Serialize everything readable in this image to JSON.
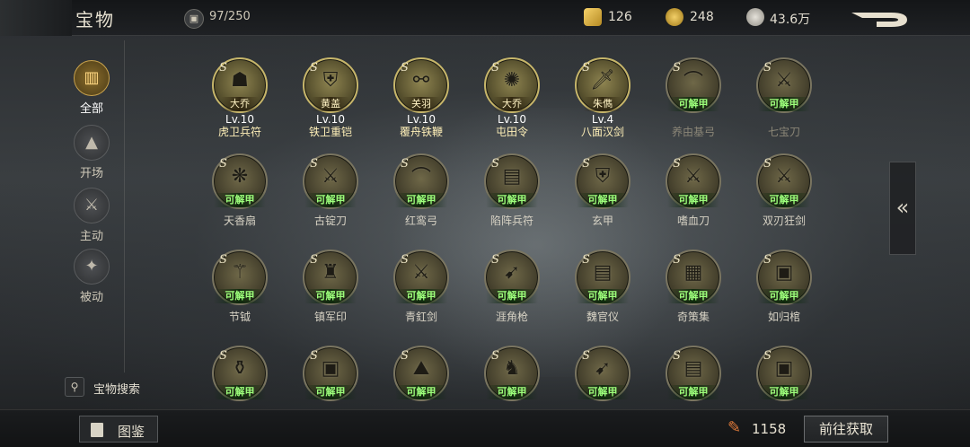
{
  "header": {
    "title": "宝物",
    "capacity": "97/250",
    "currency": [
      {
        "icon": "gold-ingot-icon",
        "value": "126"
      },
      {
        "icon": "gold-coin-icon",
        "value": "248"
      },
      {
        "icon": "silver-coin-icon",
        "value": "43.6万"
      }
    ]
  },
  "sidebar": {
    "items": [
      {
        "label": "全部",
        "icon": "all-icon"
      },
      {
        "label": "开场",
        "icon": "opening-icon"
      },
      {
        "label": "主动",
        "icon": "active-icon"
      },
      {
        "label": "被动",
        "icon": "passive-icon"
      }
    ],
    "search_label": "宝物搜索"
  },
  "tags": {
    "unlock": "可解甲"
  },
  "grid": [
    {
      "name": "虎卫兵符",
      "owner": "大乔",
      "level": "Lv.10",
      "state": "own"
    },
    {
      "name": "铁卫重铠",
      "owner": "黄盖",
      "level": "Lv.10",
      "state": "own"
    },
    {
      "name": "覆舟铁鞭",
      "owner": "关羽",
      "level": "Lv.10",
      "state": "own"
    },
    {
      "name": "屯田令",
      "owner": "大乔",
      "level": "Lv.10",
      "state": "own"
    },
    {
      "name": "八面汉剑",
      "owner": "朱儁",
      "level": "Lv.4",
      "state": "own"
    },
    {
      "name": "养由基弓",
      "state": "dim"
    },
    {
      "name": "七宝刀",
      "state": "dim"
    },
    {
      "name": "天香扇",
      "state": "plain"
    },
    {
      "name": "古锭刀",
      "state": "plain"
    },
    {
      "name": "红鸾弓",
      "state": "plain"
    },
    {
      "name": "陷阵兵符",
      "state": "plain"
    },
    {
      "name": "玄甲",
      "state": "plain"
    },
    {
      "name": "嗜血刀",
      "state": "plain"
    },
    {
      "name": "双刃狂剑",
      "state": "plain"
    },
    {
      "name": "节钺",
      "state": "plain"
    },
    {
      "name": "镇军印",
      "state": "plain"
    },
    {
      "name": "青釭剑",
      "state": "plain"
    },
    {
      "name": "涯角枪",
      "state": "plain"
    },
    {
      "name": "魏官仪",
      "state": "plain"
    },
    {
      "name": "奇策集",
      "state": "plain"
    },
    {
      "name": "如归棺",
      "state": "plain"
    },
    {
      "name": "",
      "state": "plain"
    },
    {
      "name": "",
      "state": "plain"
    },
    {
      "name": "",
      "state": "plain"
    },
    {
      "name": "",
      "state": "plain"
    },
    {
      "name": "",
      "state": "plain"
    },
    {
      "name": "",
      "state": "plain"
    },
    {
      "name": "",
      "state": "plain"
    }
  ],
  "collapse_glyph": "«",
  "bottom": {
    "book_label": "图鉴",
    "fragments": "1158",
    "get_label": "前往获取"
  }
}
